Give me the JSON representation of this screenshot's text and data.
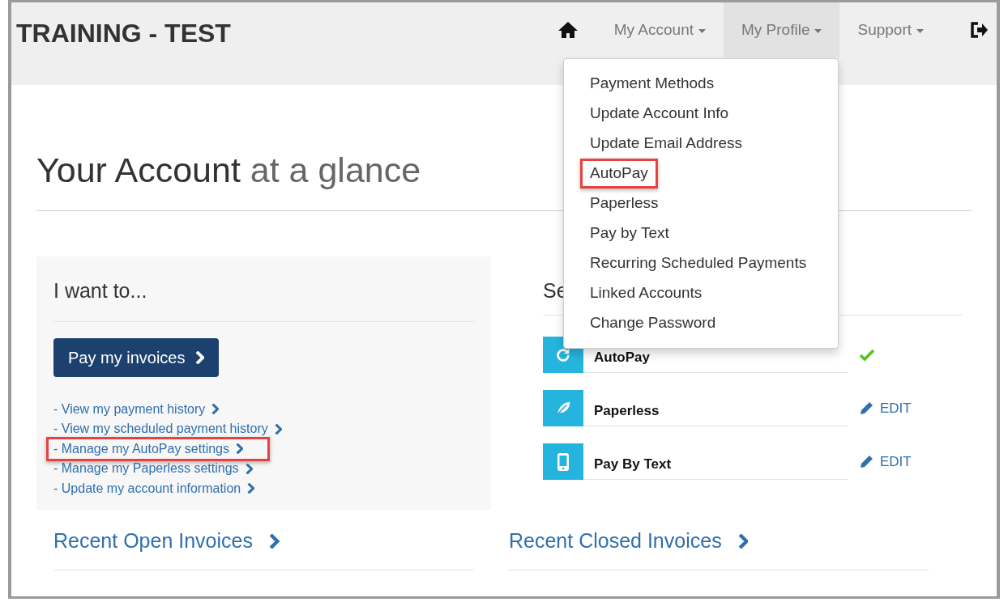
{
  "brand": "TRAINING - TEST",
  "nav": [
    {
      "kind": "home",
      "selected": false
    },
    {
      "kind": "menu",
      "label": "My Account",
      "selected": false
    },
    {
      "kind": "menu",
      "label": "My Profile",
      "selected": true
    },
    {
      "kind": "menu",
      "label": "Support",
      "selected": false
    },
    {
      "kind": "logout",
      "selected": false
    }
  ],
  "dropdown": [
    {
      "label": "Payment Methods",
      "highlighted": false
    },
    {
      "label": "Update Account Info",
      "highlighted": false
    },
    {
      "label": "Update Email Address",
      "highlighted": false
    },
    {
      "label": "AutoPay",
      "highlighted": true
    },
    {
      "label": "Paperless",
      "highlighted": false
    },
    {
      "label": "Pay by Text",
      "highlighted": false
    },
    {
      "label": "Recurring Scheduled Payments",
      "highlighted": false
    },
    {
      "label": "Linked Accounts",
      "highlighted": false
    },
    {
      "label": "Change Password",
      "highlighted": false
    }
  ],
  "heading": {
    "strong": "Your Account",
    "light": "at a glance"
  },
  "actions": {
    "title": "I want to...",
    "button": "Pay my invoices",
    "links": [
      {
        "label": "- View my payment history",
        "highlighted": false
      },
      {
        "label": "- View my scheduled payment history",
        "highlighted": false
      },
      {
        "label": "- Manage my AutoPay settings",
        "highlighted": true
      },
      {
        "label": "- Manage my Paperless settings",
        "highlighted": false
      },
      {
        "label": "- Update my account information",
        "highlighted": false
      }
    ]
  },
  "services": {
    "title": "Se",
    "rows": [
      {
        "label": "AutoPay",
        "kind": "enabled"
      },
      {
        "label": "Paperless",
        "kind": "edit",
        "action": "EDIT"
      },
      {
        "label": "Pay By Text",
        "kind": "edit",
        "action": "EDIT"
      }
    ]
  },
  "sections": [
    "Recent Open Invoices",
    "Recent Closed Invoices"
  ]
}
